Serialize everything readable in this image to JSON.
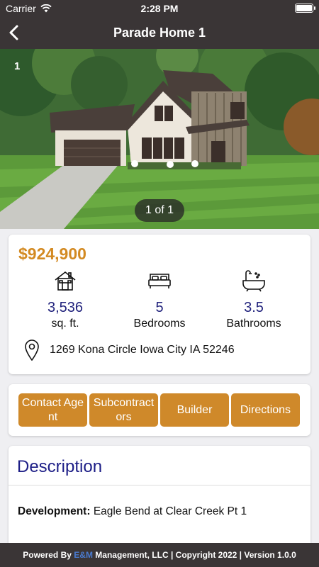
{
  "status_bar": {
    "carrier": "Carrier",
    "time": "2:28 PM"
  },
  "nav": {
    "title": "Parade Home 1"
  },
  "gallery": {
    "index": "1",
    "counter": "1 of 1"
  },
  "listing": {
    "price": "$924,900",
    "stats": [
      {
        "value": "3,536",
        "label": "sq. ft.",
        "icon": "house-icon"
      },
      {
        "value": "5",
        "label": "Bedrooms",
        "icon": "bed-icon"
      },
      {
        "value": "3.5",
        "label": "Bathrooms",
        "icon": "bathtub-icon"
      }
    ],
    "address": "1269 Kona Circle Iowa City IA 52246"
  },
  "actions": {
    "contact": "Contact Agent",
    "subcontractors": "Subcontractors",
    "builder": "Builder",
    "directions": "Directions"
  },
  "description": {
    "title": "Description",
    "development_label": "Development:",
    "development_value": "Eagle Bend at Clear Creek Pt 1"
  },
  "footer": {
    "prefix": "Powered By ",
    "brand": "E&M",
    "suffix": " Management, LLC | Copyright 2022 | Version 1.0.0"
  },
  "colors": {
    "accent": "#cf892a",
    "price": "#d38a22",
    "navy": "#22237d",
    "bar": "#3a3536"
  }
}
